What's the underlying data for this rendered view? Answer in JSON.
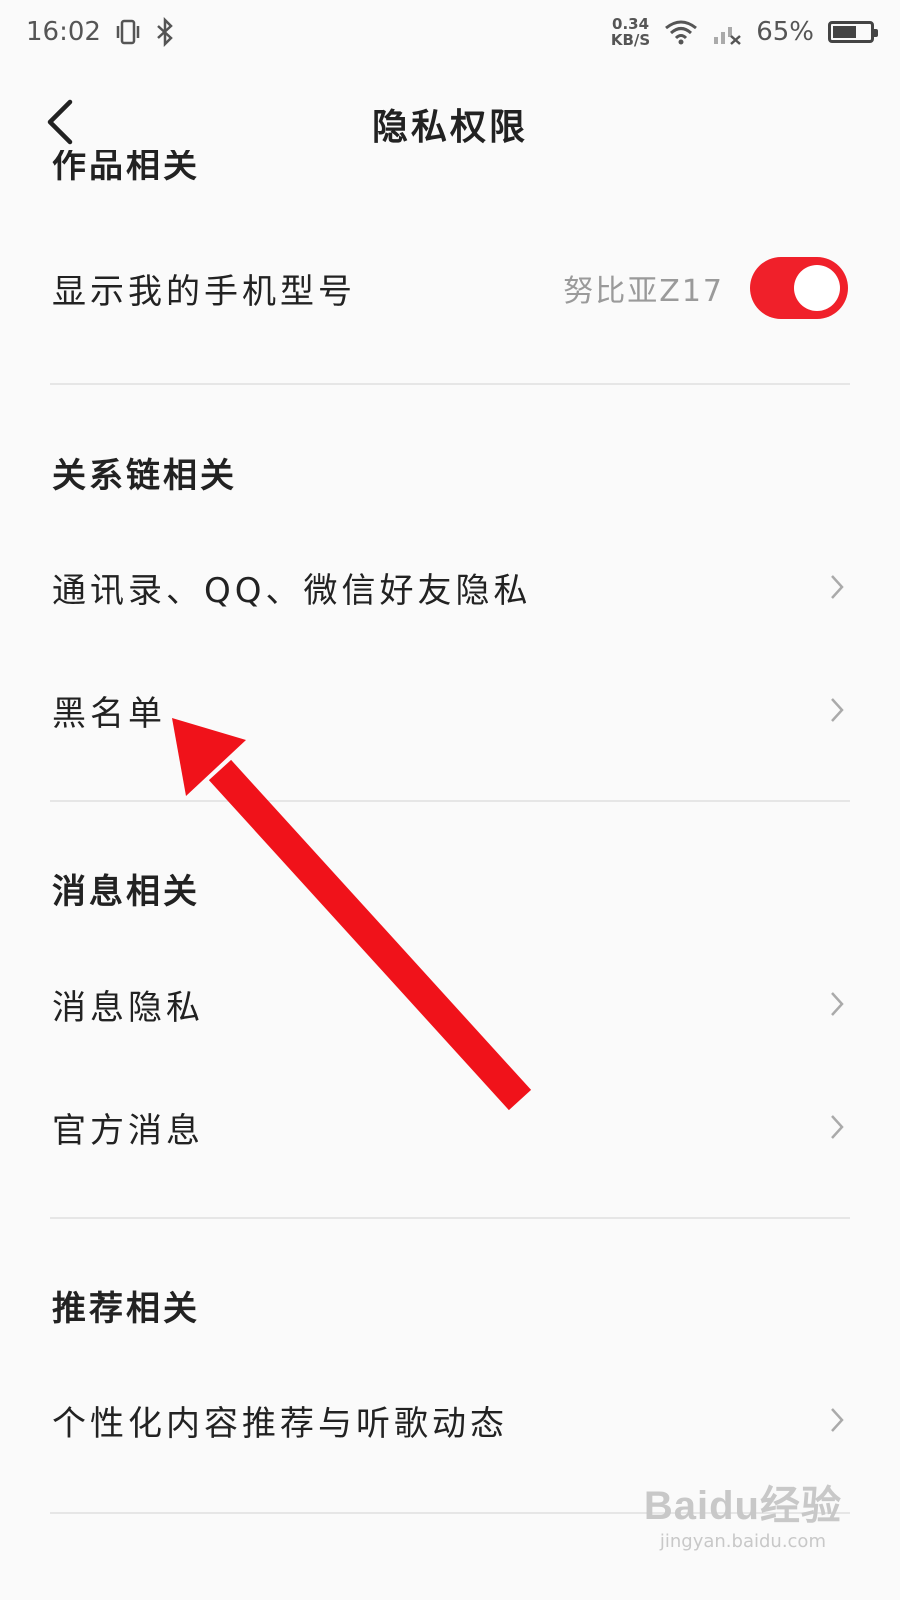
{
  "status_bar": {
    "time": "16:02",
    "net_speed_value": "0.34",
    "net_speed_unit": "KB/S",
    "battery_percent": "65%",
    "battery_level": 0.65,
    "icons": [
      "vibrate-icon",
      "bluetooth-icon",
      "wifi-icon",
      "signal-icon",
      "battery-icon"
    ]
  },
  "nav": {
    "title": "隐私权限"
  },
  "sections": {
    "work_header_partial": "作品相关",
    "show_phone_label": "显示我的手机型号",
    "show_phone_value": "努比亚Z17",
    "show_phone_enabled": true,
    "relations_header": "关系链相关",
    "contacts_label": "通讯录、QQ、微信好友隐私",
    "blacklist_label": "黑名单",
    "message_header": "消息相关",
    "message_privacy_label": "消息隐私",
    "official_message_label": "官方消息",
    "recommend_header": "推荐相关",
    "personalized_label": "个性化内容推荐与听歌动态"
  },
  "colors": {
    "toggle_on": "#f0202a",
    "annotation_arrow": "#f0121a"
  },
  "watermark": {
    "logo": "Baidu经验",
    "url": "jingyan.baidu.com"
  }
}
